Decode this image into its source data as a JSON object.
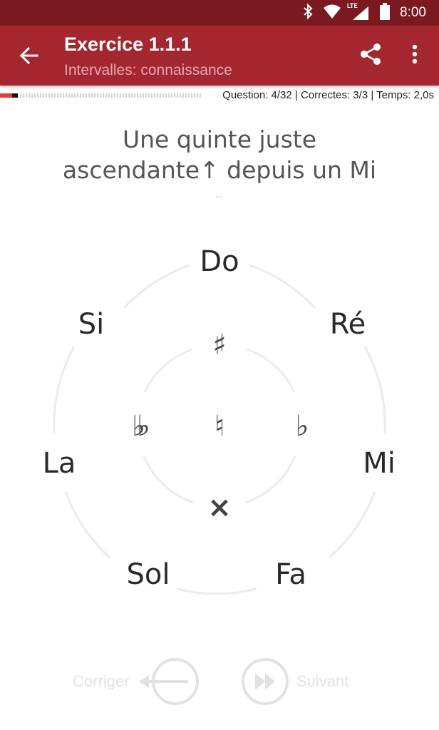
{
  "status_bar": {
    "time": "8:00",
    "network_label": "LTE",
    "icons": [
      "bluetooth-icon",
      "wifi-icon",
      "signal-icon",
      "battery-icon"
    ]
  },
  "app_bar": {
    "title": "Exercice 1.1.1",
    "subtitle": "Intervalles: connaissance",
    "icons": [
      "back-arrow-icon",
      "share-icon",
      "more-vert-icon"
    ]
  },
  "progress": {
    "stats": "Question: 4/32 | Correctes: 3/3 | Temps: 2,0s",
    "fraction": 0.09
  },
  "question": {
    "line1": "Une quinte juste",
    "line2": "ascendante↑ depuis un Mi",
    "ellipsis": "..."
  },
  "wheel": {
    "notes": {
      "do": "Do",
      "re": "Ré",
      "mi": "Mi",
      "fa": "Fa",
      "sol": "Sol",
      "la": "La",
      "si": "Si"
    },
    "accidentals": {
      "sharp": "♯",
      "flat": "♭",
      "natural": "♮",
      "double_flat": "♭♭",
      "double_sharp": "×"
    }
  },
  "actions": {
    "correct_label": "Corriger",
    "next_label": "Suivant"
  },
  "colors": {
    "status_bar": "#7a1a20",
    "app_bar": "#a4272f",
    "subtitle": "#e6a8ac",
    "progress_fill": "#e53935"
  }
}
